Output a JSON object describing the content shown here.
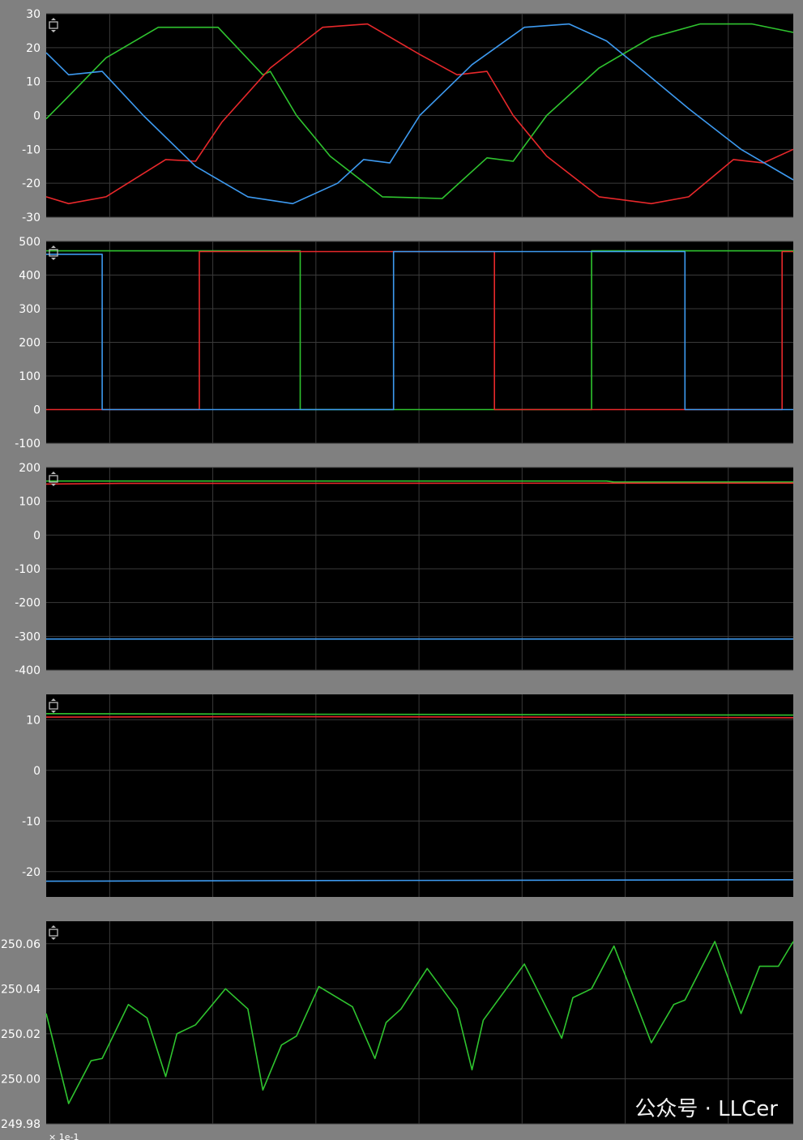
{
  "colors": {
    "background": "#808080",
    "plot_bg": "#000000",
    "grid": "#3a3a3a",
    "red": "#e8282b",
    "green": "#2fc42f",
    "blue": "#3d9af0"
  },
  "icons": {
    "panel_resize": "vertical-resize-icon"
  },
  "watermark": "公众号 · LLCer",
  "x_axis_footer": "× 1e-1",
  "chart_data": [
    {
      "type": "line",
      "xlim": [
        0,
        1
      ],
      "ylim": [
        -30,
        30
      ],
      "yticks": [
        "30",
        "20",
        "10",
        "0",
        "-10",
        "-20",
        "-30"
      ],
      "ytick_values": [
        30,
        20,
        10,
        0,
        -10,
        -20,
        -30
      ],
      "grid": true,
      "series": [
        {
          "color": "#2fc42f",
          "x": [
            0,
            0.027,
            0.08,
            0.15,
            0.23,
            0.29,
            0.3,
            0.335,
            0.38,
            0.45,
            0.53,
            0.59,
            0.625,
            0.67,
            0.74,
            0.81,
            0.875,
            0.945,
            1.0
          ],
          "y": [
            -1,
            5,
            17,
            26,
            26,
            12,
            13,
            0,
            -12,
            -24,
            -24.5,
            -12.5,
            -13.5,
            0,
            14,
            23,
            27,
            27,
            24.5
          ]
        },
        {
          "color": "#e8282b",
          "x": [
            0,
            0.03,
            0.08,
            0.16,
            0.2,
            0.235,
            0.3,
            0.37,
            0.43,
            0.5,
            0.55,
            0.59,
            0.625,
            0.67,
            0.74,
            0.81,
            0.86,
            0.92,
            0.96,
            1.0
          ],
          "y": [
            -24,
            -26,
            -24,
            -13,
            -13.5,
            -2,
            14,
            26,
            27,
            18,
            12,
            13,
            0,
            -12,
            -24,
            -26,
            -24,
            -13,
            -14,
            -10
          ]
        },
        {
          "color": "#3d9af0",
          "x": [
            0,
            0.03,
            0.075,
            0.13,
            0.2,
            0.27,
            0.33,
            0.39,
            0.425,
            0.46,
            0.5,
            0.57,
            0.64,
            0.7,
            0.75,
            0.8,
            0.86,
            0.93,
            1.0
          ],
          "y": [
            18.5,
            12,
            13,
            0,
            -15,
            -24,
            -26,
            -20,
            -13,
            -14,
            0,
            15,
            26,
            27,
            22,
            13,
            2,
            -10,
            -19
          ]
        }
      ]
    },
    {
      "type": "line",
      "xlim": [
        0,
        1
      ],
      "ylim": [
        -100,
        500
      ],
      "yticks": [
        "500",
        "400",
        "300",
        "200",
        "100",
        "0",
        "-100"
      ],
      "ytick_values": [
        500,
        400,
        300,
        200,
        100,
        0,
        -100
      ],
      "grid": true,
      "series": [
        {
          "color": "#2fc42f",
          "step": true,
          "x": [
            0,
            0.33,
            0.34,
            0.73,
            1.0
          ],
          "y": [
            472,
            472,
            0,
            472,
            468
          ]
        },
        {
          "color": "#e8282b",
          "step": true,
          "x": [
            0,
            0.205,
            0.6,
            0.985,
            1.0
          ],
          "y": [
            0,
            470,
            0,
            470,
            470
          ]
        },
        {
          "color": "#3d9af0",
          "step": true,
          "x": [
            0,
            0.075,
            0.465,
            0.855,
            1.0
          ],
          "y": [
            462,
            0,
            470,
            0,
            0
          ]
        }
      ]
    },
    {
      "type": "line",
      "xlim": [
        0,
        1
      ],
      "ylim": [
        -400,
        200
      ],
      "yticks": [
        "200",
        "100",
        "0",
        "-100",
        "-200",
        "-300",
        "-400"
      ],
      "ytick_values": [
        200,
        100,
        0,
        -100,
        -200,
        -300,
        -400
      ],
      "grid": true,
      "series": [
        {
          "color": "#2fc42f",
          "x": [
            0,
            0.75,
            0.76,
            1.0
          ],
          "y": [
            160,
            160,
            157,
            157
          ]
        },
        {
          "color": "#e8282b",
          "x": [
            0,
            0.1,
            1.0
          ],
          "y": [
            151,
            153,
            154
          ]
        },
        {
          "color": "#3d9af0",
          "x": [
            0,
            1.0
          ],
          "y": [
            -308,
            -308
          ]
        }
      ]
    },
    {
      "type": "line",
      "xlim": [
        0,
        1
      ],
      "ylim": [
        -25,
        15
      ],
      "yticks": [
        "10",
        "0",
        "-10",
        "-20"
      ],
      "ytick_values": [
        10,
        0,
        -10,
        -20
      ],
      "grid": true,
      "series": [
        {
          "color": "#2fc42f",
          "x": [
            0,
            0.3,
            1.0
          ],
          "y": [
            11.2,
            11.1,
            10.9
          ]
        },
        {
          "color": "#e8282b",
          "x": [
            0,
            0.3,
            1.0
          ],
          "y": [
            10.5,
            10.6,
            10.4
          ]
        },
        {
          "color": "#3d9af0",
          "x": [
            0,
            0.26,
            1.0
          ],
          "y": [
            -21.9,
            -21.8,
            -21.6
          ]
        }
      ]
    },
    {
      "type": "line",
      "xlim": [
        0,
        1
      ],
      "ylim": [
        249.98,
        250.07
      ],
      "yticks": [
        "250.06",
        "250.04",
        "250.02",
        "250.00",
        "249.98"
      ],
      "ytick_values": [
        250.06,
        250.04,
        250.02,
        250.0,
        249.98
      ],
      "grid": true,
      "series": [
        {
          "color": "#2fc42f",
          "x": [
            0,
            0.03,
            0.06,
            0.075,
            0.11,
            0.135,
            0.16,
            0.175,
            0.2,
            0.24,
            0.27,
            0.29,
            0.315,
            0.335,
            0.365,
            0.41,
            0.44,
            0.455,
            0.475,
            0.51,
            0.55,
            0.57,
            0.585,
            0.64,
            0.69,
            0.705,
            0.73,
            0.76,
            0.81,
            0.84,
            0.855,
            0.895,
            0.93,
            0.955,
            0.98,
            1.0
          ],
          "y": [
            250.029,
            249.989,
            250.008,
            250.009,
            250.033,
            250.027,
            250.001,
            250.02,
            250.024,
            250.04,
            250.031,
            249.995,
            250.015,
            250.019,
            250.041,
            250.032,
            250.009,
            250.025,
            250.031,
            250.049,
            250.031,
            250.004,
            250.026,
            250.051,
            250.018,
            250.036,
            250.04,
            250.059,
            250.016,
            250.033,
            250.035,
            250.061,
            250.029,
            250.05,
            250.05,
            250.061
          ]
        }
      ]
    }
  ]
}
